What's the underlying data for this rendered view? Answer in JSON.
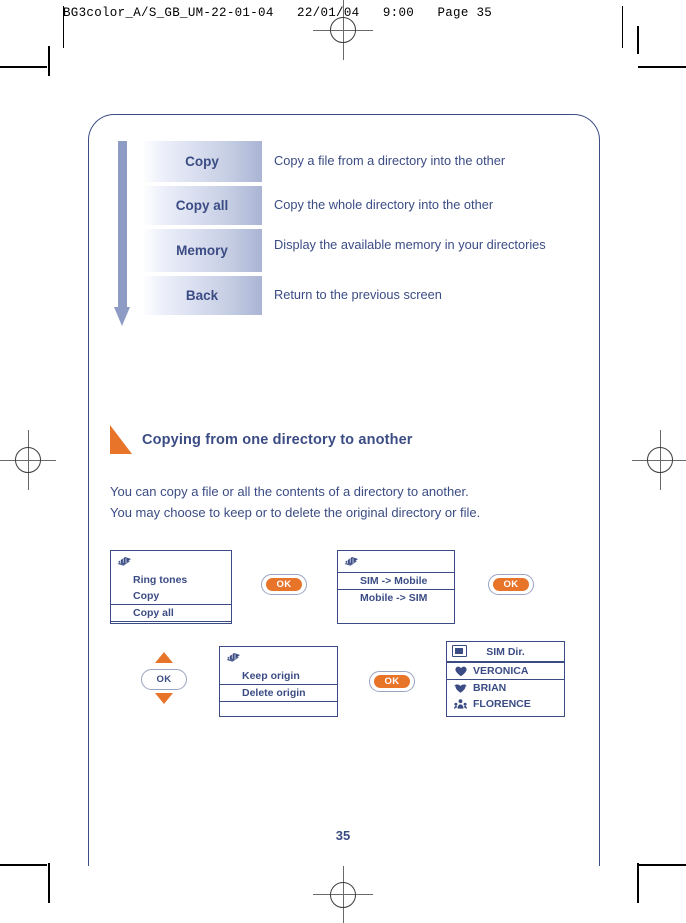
{
  "prepress": {
    "header_text": "BG3color_A/S_GB_UM-22-01-04   22/01/04   9:00   Page 35"
  },
  "menu_table": {
    "arrow_icon": "down-arrow-icon",
    "rows": [
      {
        "key": "Copy",
        "description": "Copy a file from a directory into the other"
      },
      {
        "key": "Copy all",
        "description": "Copy the whole directory into the other"
      },
      {
        "key": "Memory",
        "description": "Display the available memory in your directories"
      },
      {
        "key": "Back",
        "description": "Return to the previous screen"
      }
    ]
  },
  "section": {
    "bullet_icon": "orange-triangle-icon",
    "title": "Copying from one directory to another",
    "paragraph_line1": "You can copy a file or all the contents of a directory to another.",
    "paragraph_line2": "You may choose to keep or to delete the original directory or file."
  },
  "flow": {
    "screen1": {
      "icon": "media-notes-icon",
      "items": [
        {
          "label": "Ring tones",
          "selected": false
        },
        {
          "label": "Copy",
          "selected": false
        },
        {
          "label": "Copy all",
          "selected": true
        }
      ]
    },
    "ok1": {
      "label": "OK"
    },
    "screen2": {
      "icon": "media-notes-icon",
      "items": [
        {
          "label": "SIM -> Mobile",
          "selected": true
        },
        {
          "label": "Mobile -> SIM",
          "selected": false
        }
      ]
    },
    "ok2": {
      "label": "OK"
    },
    "nav": {
      "label": "OK",
      "up_icon": "triangle-up-icon",
      "down_icon": "triangle-down-icon"
    },
    "screen3": {
      "icon": "media-notes-icon",
      "items": [
        {
          "label": "Keep origin",
          "selected": false
        },
        {
          "label": "Delete origin",
          "selected": true
        }
      ]
    },
    "ok3": {
      "label": "OK"
    },
    "screen4": {
      "icon": "sim-card-icon",
      "title": "SIM Dir.",
      "contacts": [
        {
          "name": "VERONICA",
          "icon": "heart-icon",
          "selected": true
        },
        {
          "name": "BRIAN",
          "icon": "heart-wings-icon",
          "selected": false
        },
        {
          "name": "FLORENCE",
          "icon": "group-people-icon",
          "selected": false
        }
      ]
    }
  },
  "footer": {
    "page_number": "35"
  },
  "colors": {
    "brand_blue": "#3b4c84",
    "accent_orange": "#e8742a",
    "arrow_blue": "#8e9bc4"
  }
}
